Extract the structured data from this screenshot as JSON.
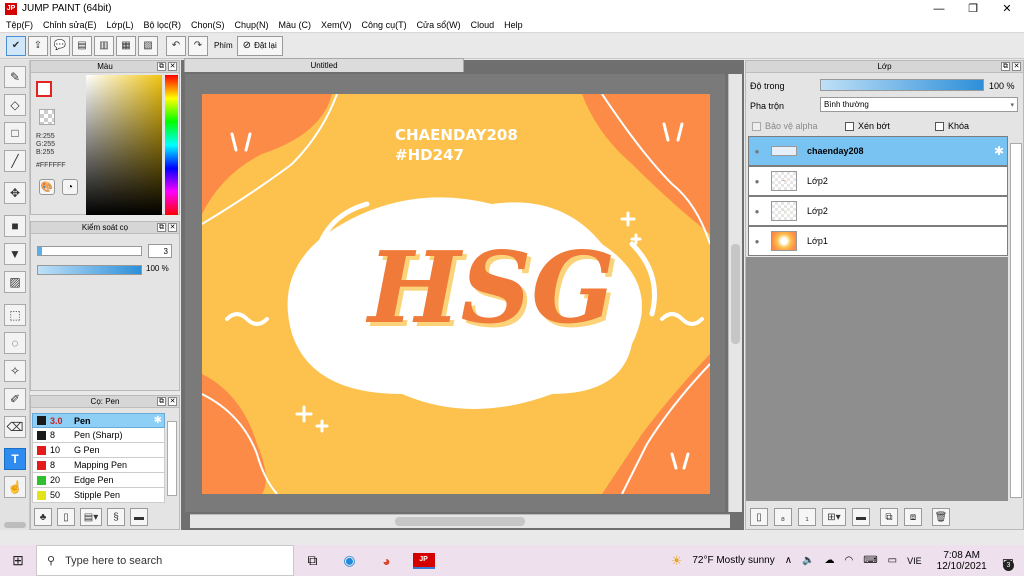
{
  "app": {
    "title": "JUMP PAINT (64bit)",
    "icon_text": "JP"
  },
  "window_controls": {
    "minimize": "—",
    "maximize": "❐",
    "close": "✕"
  },
  "menu": [
    "Tệp(F)",
    "Chỉnh sửa(E)",
    "Lớp(L)",
    "Bộ lọc(R)",
    "Chọn(S)",
    "Chụp(N)",
    "Màu (C)",
    "Xem(V)",
    "Công cụ(T)",
    "Cửa sổ(W)",
    "Cloud",
    "Help"
  ],
  "toolbar": {
    "shortcut_label": "Phím",
    "reset_label": "Đặt lại"
  },
  "color_panel": {
    "title": "Màu",
    "r": "R:255",
    "g": "G:255",
    "b": "B:255",
    "hex": "#FFFFFF"
  },
  "brush_control": {
    "title": "Kiểm soát cọ",
    "size": "3",
    "opacity": "100 %"
  },
  "brush_panel": {
    "title": "Cọ: Pen",
    "items": [
      {
        "size": "3.0",
        "name": "Pen",
        "color": "#1a1a1a"
      },
      {
        "size": "8",
        "name": "Pen (Sharp)",
        "color": "#1a1a1a"
      },
      {
        "size": "10",
        "name": "G Pen",
        "color": "#e31b1b"
      },
      {
        "size": "8",
        "name": "Mapping Pen",
        "color": "#e31b1b"
      },
      {
        "size": "20",
        "name": "Edge Pen",
        "color": "#2fbf2f"
      },
      {
        "size": "50",
        "name": "Stipple Pen",
        "color": "#e3e31b"
      }
    ]
  },
  "document": {
    "tab": "Untitled"
  },
  "artwork": {
    "line1": "CHAENDAY208",
    "line2": "#HD247",
    "main": "HSG"
  },
  "layer_panel": {
    "title": "Lớp",
    "opacity_label": "Độ trong",
    "opacity_value": "100 %",
    "blend_label": "Pha trộn",
    "blend_value": "Bình thường",
    "protect_alpha": "Bảo vệ alpha",
    "clipping": "Xén bớt",
    "lock": "Khóa",
    "layers": [
      {
        "name": "chaenday208"
      },
      {
        "name": "Lớp2"
      },
      {
        "name": "Lớp2"
      },
      {
        "name": "Lớp1"
      }
    ]
  },
  "taskbar": {
    "search_placeholder": "Type here to search",
    "weather": "72°F  Mostly sunny",
    "lang": "VIE",
    "time": "7:08 AM",
    "date": "12/10/2021",
    "notifications": "3"
  }
}
